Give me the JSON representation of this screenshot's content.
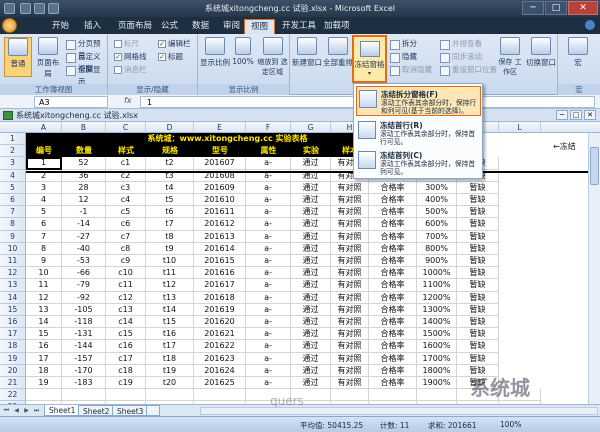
{
  "window": {
    "title": "系统城xitongcheng.cc 试验.xlsx - Microsoft Excel",
    "minimize": "─",
    "restore": "□",
    "close": "✕"
  },
  "tabs": [
    "开始",
    "插入",
    "页面布局",
    "公式",
    "数据",
    "审阅",
    "视图",
    "开发工具",
    "加载项"
  ],
  "active_tab": "视图",
  "ribbon": {
    "workbook_views": {
      "label": "工作簿视图",
      "normal": "普通",
      "page_layout": "页面布局",
      "page_break": "分页预览",
      "custom": "自定义视图",
      "full": "全屏显示"
    },
    "show_hide": {
      "label": "显示/隐藏",
      "ruler": "标尺",
      "gridlines": "网格线",
      "message_bar": "消息栏",
      "formula_bar": "编辑栏",
      "headings": "标题"
    },
    "zoom": {
      "label": "显示比例",
      "zoom": "显示比例",
      "hundred": "100%",
      "zoom_selection": "缩放到\n选定区域"
    },
    "window": {
      "new_window": "新建窗口",
      "arrange_all": "全部重排",
      "freeze": "冻结窗格",
      "split": "拆分",
      "hide": "隐藏",
      "unhide": "取消隐藏",
      "side_by_side": "并排查看",
      "sync_scroll": "同步滚动",
      "reset_pos": "重设窗口位置",
      "save_ws": "保存\n工作区",
      "switch": "切换窗口"
    },
    "macros": {
      "label": "宏",
      "macro": "宏"
    }
  },
  "formula_bar": {
    "cell_ref": "A3",
    "fx": "fx",
    "value": "1"
  },
  "workbook_title": "系统城xitongcheng.cc 试验.xlsx",
  "freeze_menu": {
    "items": [
      {
        "title": "冻结拆分窗格(F)",
        "desc": "滚动工作表其余部分时，保持行和列可见(基于当前的选择)。"
      },
      {
        "title": "冻结首行(R)",
        "desc": "滚动工作表其余部分时，保持首行可见。"
      },
      {
        "title": "冻结首列(C)",
        "desc": "滚动工作表其余部分时，保持首列可见。"
      }
    ]
  },
  "sheet": {
    "columns": [
      "A",
      "B",
      "C",
      "D",
      "E",
      "F",
      "G",
      "H",
      "I",
      "J",
      "K",
      "L"
    ],
    "title_row": "系统城：www.xitongcheng.cc 实验表格",
    "headers": [
      "编号",
      "数量",
      "样式",
      "规格",
      "型号",
      "属性",
      "实验",
      "样本",
      "",
      "",
      "",
      ""
    ],
    "row_numbers": [
      "1",
      "2",
      "3",
      "4",
      "5",
      "6",
      "7",
      "8",
      "9",
      "10",
      "11",
      "12",
      "13",
      "14",
      "15",
      "16",
      "17",
      "18",
      "19",
      "20",
      "21",
      "22",
      "23"
    ],
    "rows": [
      [
        "1",
        "52",
        "c1",
        "t2",
        "201607",
        "a-",
        "通过",
        "有对照",
        "合格率",
        "200%",
        "暂缺"
      ],
      [
        "2",
        "36",
        "c2",
        "t3",
        "201608",
        "a-",
        "通过",
        "有对照",
        "合格率",
        "300%",
        "暂缺"
      ],
      [
        "3",
        "28",
        "c3",
        "t4",
        "201609",
        "a-",
        "通过",
        "有对照",
        "合格率",
        "300%",
        "暂缺"
      ],
      [
        "4",
        "12",
        "c4",
        "t5",
        "201610",
        "a-",
        "通过",
        "有对照",
        "合格率",
        "400%",
        "暂缺"
      ],
      [
        "5",
        "-1",
        "c5",
        "t6",
        "201611",
        "a-",
        "通过",
        "有对照",
        "合格率",
        "500%",
        "暂缺"
      ],
      [
        "6",
        "-14",
        "c6",
        "t7",
        "201612",
        "a-",
        "通过",
        "有对照",
        "合格率",
        "600%",
        "暂缺"
      ],
      [
        "7",
        "-27",
        "c7",
        "t8",
        "201613",
        "a-",
        "通过",
        "有对照",
        "合格率",
        "700%",
        "暂缺"
      ],
      [
        "8",
        "-40",
        "c8",
        "t9",
        "201614",
        "a-",
        "通过",
        "有对照",
        "合格率",
        "800%",
        "暂缺"
      ],
      [
        "9",
        "-53",
        "c9",
        "t10",
        "201615",
        "a-",
        "通过",
        "有对照",
        "合格率",
        "900%",
        "暂缺"
      ],
      [
        "10",
        "-66",
        "c10",
        "t11",
        "201616",
        "a-",
        "通过",
        "有对照",
        "合格率",
        "1000%",
        "暂缺"
      ],
      [
        "11",
        "-79",
        "c11",
        "t12",
        "201617",
        "a-",
        "通过",
        "有对照",
        "合格率",
        "1100%",
        "暂缺"
      ],
      [
        "12",
        "-92",
        "c12",
        "t13",
        "201618",
        "a-",
        "通过",
        "有对照",
        "合格率",
        "1200%",
        "暂缺"
      ],
      [
        "13",
        "-105",
        "c13",
        "t14",
        "201619",
        "a-",
        "通过",
        "有对照",
        "合格率",
        "1300%",
        "暂缺"
      ],
      [
        "14",
        "-118",
        "c14",
        "t15",
        "201620",
        "a-",
        "通过",
        "有对照",
        "合格率",
        "1400%",
        "暂缺"
      ],
      [
        "15",
        "-131",
        "c15",
        "t16",
        "201621",
        "a-",
        "通过",
        "有对照",
        "合格率",
        "1500%",
        "暂缺"
      ],
      [
        "16",
        "-144",
        "c16",
        "t17",
        "201622",
        "a-",
        "通过",
        "有对照",
        "合格率",
        "1600%",
        "暂缺"
      ],
      [
        "17",
        "-157",
        "c17",
        "t18",
        "201623",
        "a-",
        "通过",
        "有对照",
        "合格率",
        "1700%",
        "暂缺"
      ],
      [
        "18",
        "-170",
        "c18",
        "t19",
        "201624",
        "a-",
        "通过",
        "有对照",
        "合格率",
        "1800%",
        "暂缺"
      ],
      [
        "19",
        "-183",
        "c19",
        "t20",
        "201625",
        "a-",
        "通过",
        "有对照",
        "合格率",
        "1900%",
        "暂缺"
      ]
    ],
    "freeze_hint": "←冻结"
  },
  "sheet_tabs": [
    "Sheet1",
    "Sheet2",
    "Sheet3"
  ],
  "status": {
    "average": "平均值: 50415.25",
    "count": "计数: 11",
    "sum": "求和: 201661",
    "zoom": "100%"
  },
  "watermark": "系统城",
  "watermark_small": "quers",
  "colors": {
    "accent": "#e36c1b",
    "header_bg": "#000000",
    "header_text": "#ffe600"
  }
}
